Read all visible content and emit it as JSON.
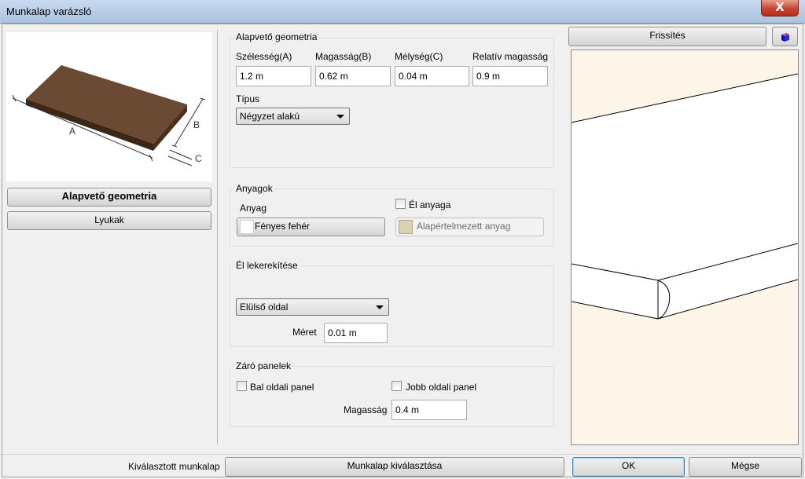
{
  "window": {
    "title": "Munkalap varázsló",
    "close_glyph": "X"
  },
  "left": {
    "preview_dims": {
      "a": "A",
      "b": "B",
      "c": "C"
    },
    "tabs": [
      {
        "label": "Alapvető geometria"
      },
      {
        "label": "Lyukak"
      }
    ]
  },
  "geometry": {
    "title": "Alapvető geometria",
    "width_label": "Szélesség(A)",
    "width_value": "1.2 m",
    "height_label": "Magasság(B)",
    "height_value": "0.62 m",
    "depth_label": "Mélység(C)",
    "depth_value": "0.04 m",
    "relheight_label": "Relatív magasság",
    "relheight_value": "0.9 m",
    "type_label": "Típus",
    "type_value": "Négyzet alakú"
  },
  "materials": {
    "title": "Anyagok",
    "material_label": "Anyag",
    "material_value": "Fényes fehér",
    "edge_checkbox_label": "Él anyaga",
    "edge_material_value": "Alapértelmezett anyag",
    "swatch_colors": {
      "material": "#ffffff",
      "edge": "#d8d2b0"
    }
  },
  "edge_rounding": {
    "title": "Él lekerekítése",
    "side_value": "Elülső oldal",
    "size_label": "Méret",
    "size_value": "0.01 m"
  },
  "end_panels": {
    "title": "Záró panelek",
    "left_label": "Bal oldali panel",
    "right_label": "Jobb oldali panel",
    "height_label": "Magasság",
    "height_value": "0.4 m"
  },
  "right": {
    "refresh_label": "Frissítés",
    "view_icon": "cube-icon"
  },
  "footer": {
    "selected_label": "Kiválasztott munkalap",
    "select_button": "Munkalap kiválasztása",
    "ok": "OK",
    "cancel": "Mégse"
  },
  "colors": {
    "board": "#6b4a33",
    "viewport_bg": "#fdf6e8"
  }
}
